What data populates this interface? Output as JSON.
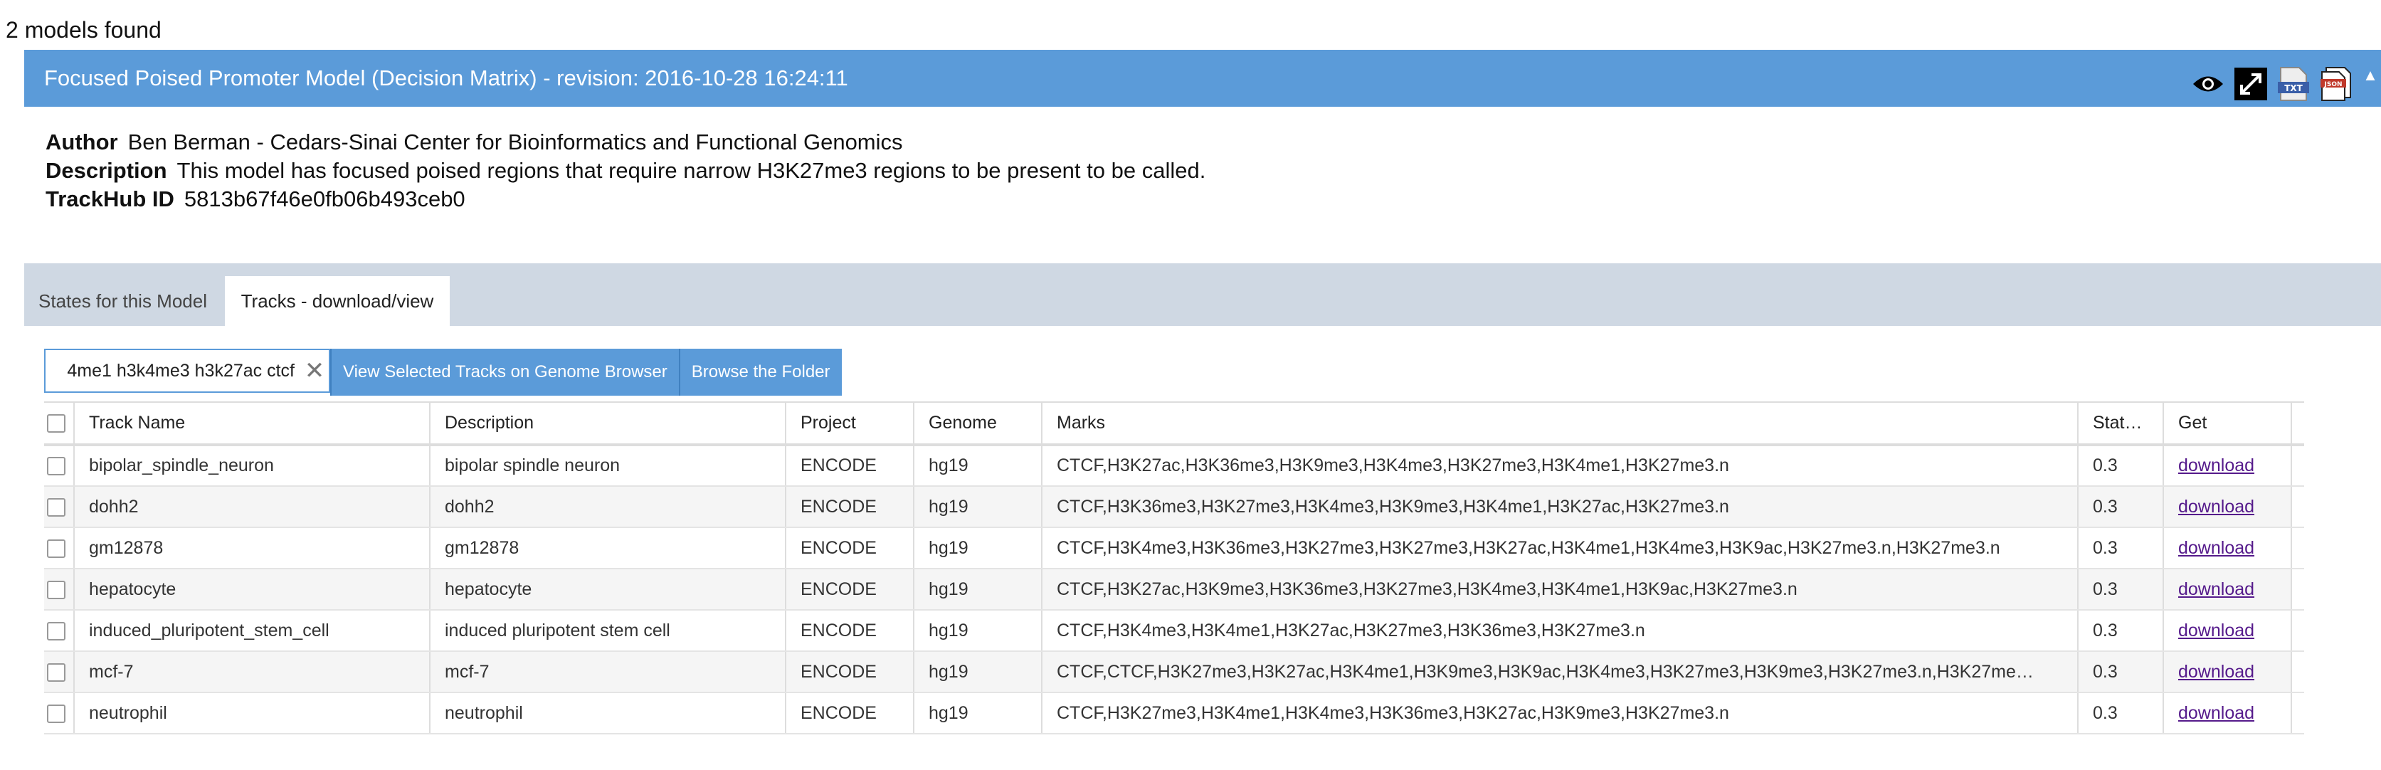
{
  "models_found": "2 models found",
  "model": {
    "title": "Focused Poised Promoter Model (Decision Matrix) - revision: 2016-10-28 16:24:11",
    "author_label": "Author",
    "author": "Ben Berman - Cedars-Sinai Center for Bioinformatics and Functional Genomics",
    "description_label": "Description",
    "description": "This model has focused poised regions that require narrow H3K27me3 regions to be present to be called.",
    "trackhub_label": "TrackHub ID",
    "trackhub_id": "5813b67f46e0fb06b493ceb0",
    "icons": [
      "eye-icon",
      "expand-icon",
      "txt-file-icon",
      "json-file-icon",
      "collapse-caret-icon"
    ],
    "icon_labels": {
      "txt": "TXT",
      "json": "JSON"
    }
  },
  "tabs": [
    {
      "label": "States for this Model",
      "active": false
    },
    {
      "label": "Tracks - download/view",
      "active": true
    }
  ],
  "toolbar": {
    "filter_value": "4me1 h3k4me3 h3k27ac ctcf",
    "view_button": "View Selected Tracks on Genome Browser",
    "browse_button": "Browse the Folder"
  },
  "table": {
    "headers": {
      "track_name": "Track Name",
      "description": "Description",
      "project": "Project",
      "genome": "Genome",
      "marks": "Marks",
      "status": "Stat…",
      "get": "Get"
    },
    "rows": [
      {
        "track_name": "bipolar_spindle_neuron",
        "description": "bipolar spindle neuron",
        "project": "ENCODE",
        "genome": "hg19",
        "marks": "CTCF,H3K27ac,H3K36me3,H3K9me3,H3K4me3,H3K27me3,H3K4me1,H3K27me3.n",
        "status": "0.3",
        "get": "download"
      },
      {
        "track_name": "dohh2",
        "description": "dohh2",
        "project": "ENCODE",
        "genome": "hg19",
        "marks": "CTCF,H3K36me3,H3K27me3,H3K4me3,H3K9me3,H3K4me1,H3K27ac,H3K27me3.n",
        "status": "0.3",
        "get": "download"
      },
      {
        "track_name": "gm12878",
        "description": "gm12878",
        "project": "ENCODE",
        "genome": "hg19",
        "marks": "CTCF,H3K4me3,H3K36me3,H3K27me3,H3K27me3,H3K27ac,H3K4me1,H3K4me3,H3K9ac,H3K27me3.n,H3K27me3.n",
        "status": "0.3",
        "get": "download"
      },
      {
        "track_name": "hepatocyte",
        "description": "hepatocyte",
        "project": "ENCODE",
        "genome": "hg19",
        "marks": "CTCF,H3K27ac,H3K9me3,H3K36me3,H3K27me3,H3K4me3,H3K4me1,H3K9ac,H3K27me3.n",
        "status": "0.3",
        "get": "download"
      },
      {
        "track_name": "induced_pluripotent_stem_cell",
        "description": "induced pluripotent stem cell",
        "project": "ENCODE",
        "genome": "hg19",
        "marks": "CTCF,H3K4me3,H3K4me1,H3K27ac,H3K27me3,H3K36me3,H3K27me3.n",
        "status": "0.3",
        "get": "download"
      },
      {
        "track_name": "mcf-7",
        "description": "mcf-7",
        "project": "ENCODE",
        "genome": "hg19",
        "marks": "CTCF,CTCF,H3K27me3,H3K27ac,H3K4me1,H3K9me3,H3K9ac,H3K4me3,H3K27me3,H3K9me3,H3K27me3.n,H3K27me…",
        "status": "0.3",
        "get": "download"
      },
      {
        "track_name": "neutrophil",
        "description": "neutrophil",
        "project": "ENCODE",
        "genome": "hg19",
        "marks": "CTCF,H3K27me3,H3K4me1,H3K4me3,H3K36me3,H3K27ac,H3K9me3,H3K27me3.n",
        "status": "0.3",
        "get": "download"
      }
    ]
  },
  "colors": {
    "header_blue": "#5b9bd9",
    "tab_bar": "#cfd8e3",
    "link": "#551a8b"
  }
}
